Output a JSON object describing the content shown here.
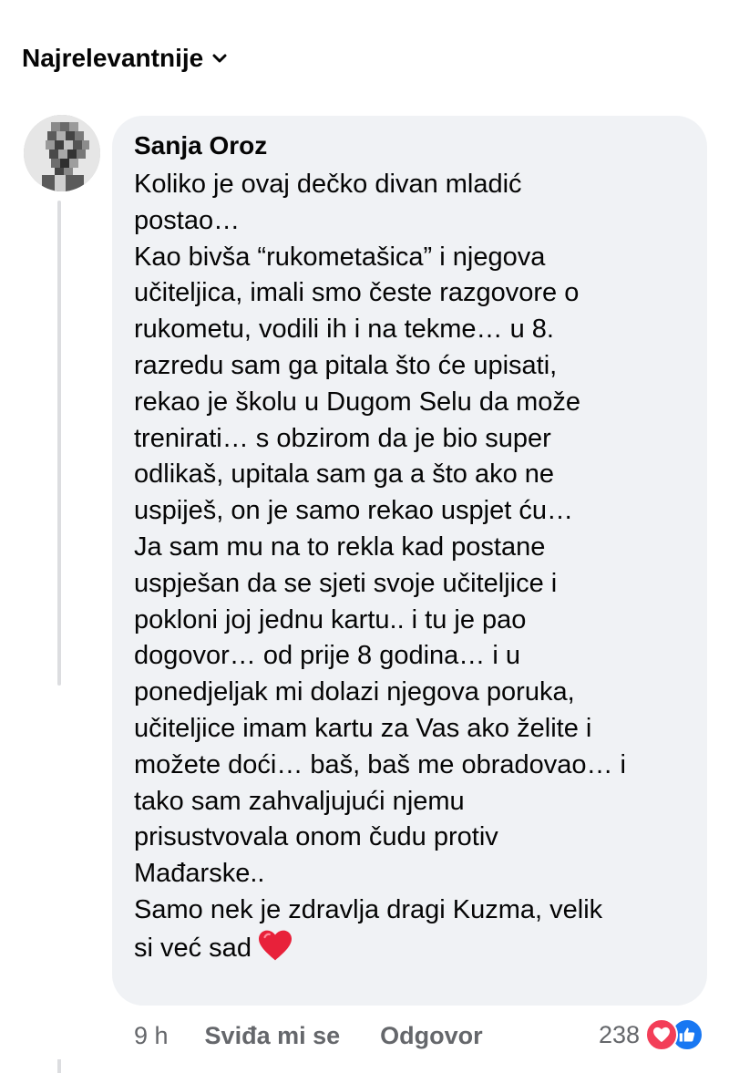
{
  "sort": {
    "label": "Najrelevantnije",
    "icon": "chevron-down-icon"
  },
  "comment": {
    "author": "Sanja Oroz",
    "lines": [
      "Koliko je ovaj dečko divan mladić",
      "postao…",
      "Kao bivša “rukometašica” i njegova",
      "učiteljica, imali smo česte razgovore o",
      "rukometu, vodili ih i na tekme… u 8.",
      "razredu sam ga pitala što će upisati,",
      "rekao je školu u Dugom Selu da može",
      "trenirati… s obzirom da je bio super",
      "odlikaš, upitala sam ga a što ako ne",
      "uspiješ, on je samo rekao uspjet ću…",
      "Ja sam mu na to rekla kad postane",
      "uspješan da se sjeti svoje učiteljice i",
      "pokloni joj jednu kartu.. i tu je pao",
      "dogovor… od prije 8 godina… i u",
      "ponedjeljak mi dolazi njegova poruka,",
      "učiteljice imam kartu za Vas ako želite i",
      "možete doći… baš, baš me obradovao… i",
      "tako sam zahvaljujući njemu",
      "prisustvovala onom čudu protiv",
      "Mađarske..",
      "Samo nek je zdravlja dragi Kuzma, velik",
      "si već sad"
    ],
    "emoji": "red-heart-emoji",
    "time": "9 h",
    "like_label": "Sviđa mi se",
    "reply_label": "Odgovor",
    "reaction_count": "238",
    "reaction_icons": [
      "heart-reaction-icon",
      "like-reaction-icon"
    ]
  },
  "colors": {
    "bubble": "#f0f2f5",
    "secondary_text": "#65676b",
    "heart": "#f33e58",
    "like": "#1877f2"
  }
}
